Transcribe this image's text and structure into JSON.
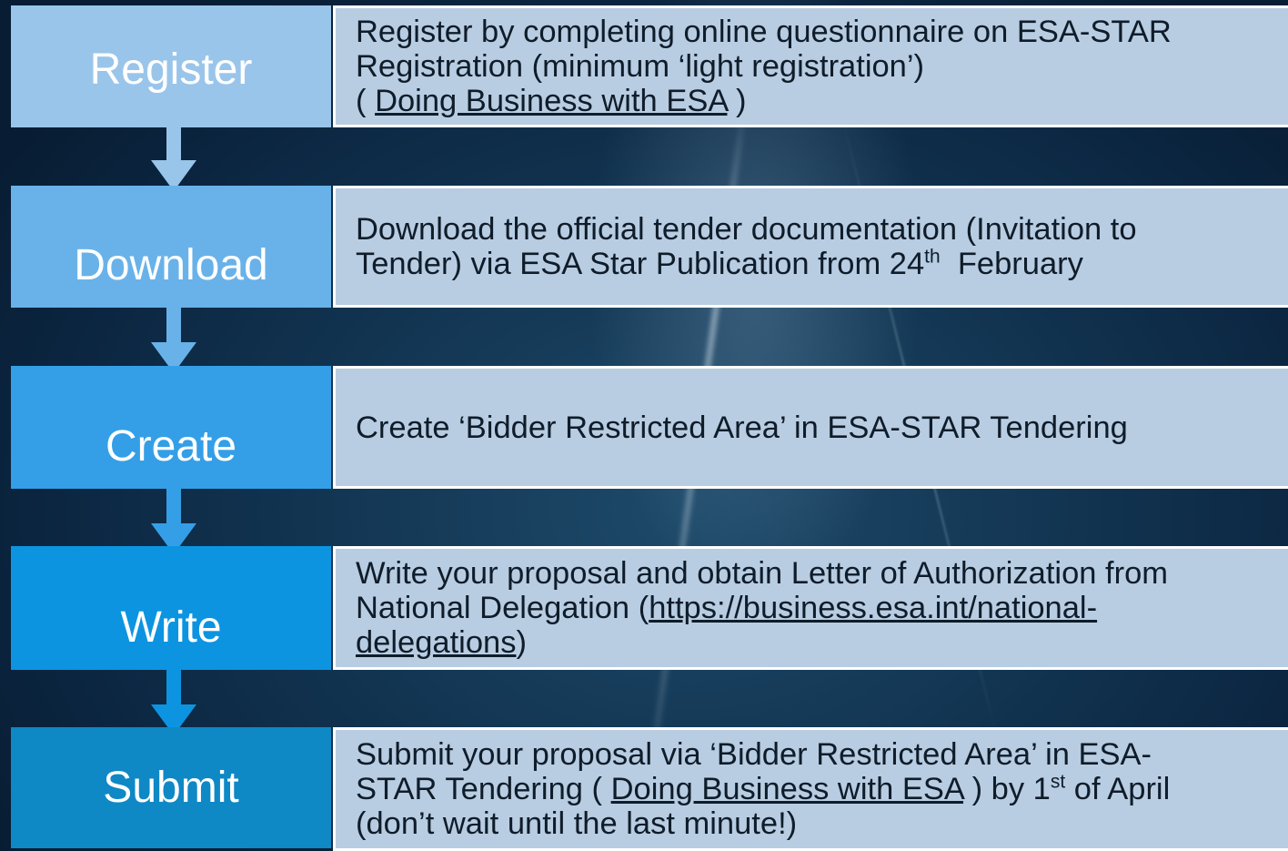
{
  "colors": {
    "register": "#9ac5ea",
    "download": "#69b2e9",
    "create": "#349fe7",
    "write": "#0c94e1",
    "submit": "#0f88c6",
    "box_fill": "#b8cde2"
  },
  "steps": [
    {
      "label": "Register",
      "desc": {
        "line1": "Register by completing online questionnaire on ESA-STAR",
        "line2": "Registration (minimum ‘light registration’)",
        "open": "( ",
        "link": "Doing Business with ESA",
        "close": " )"
      }
    },
    {
      "label": "Download",
      "desc": {
        "line1": "Download the official tender documentation (Invitation to",
        "line2_pre": "Tender) via ESA Star Publication from 24",
        "sup": "th",
        "line2_post": "  February"
      }
    },
    {
      "label": "Create",
      "desc": {
        "text": "Create ‘Bidder Restricted Area’ in ESA-STAR Tendering"
      }
    },
    {
      "label": "Write",
      "desc": {
        "line1": "Write your proposal and obtain Letter of Authorization from",
        "line2_pre": "National Delegation (",
        "link_part1": "https://business.esa.int/national-",
        "link_part2": "delegations",
        "close": ")"
      }
    },
    {
      "label": "Submit",
      "desc": {
        "line1": "Submit your proposal via ‘Bidder Restricted Area’ in ESA-",
        "line2_pre": "STAR Tendering ( ",
        "link": "Doing Business with ESA",
        "line2_mid": " ) by 1",
        "sup": "st",
        "line2_post": " of April",
        "line3": "(don’t wait until the last minute!)"
      }
    }
  ]
}
